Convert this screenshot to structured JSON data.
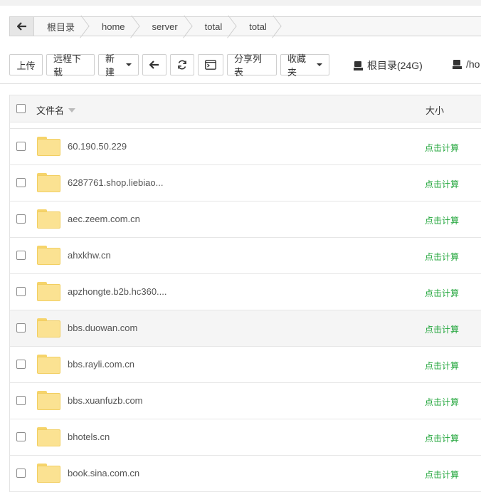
{
  "breadcrumb": {
    "items": [
      "根目录",
      "home",
      "server",
      "total",
      "total"
    ]
  },
  "toolbar": {
    "upload": "上传",
    "remote_download": "远程下载",
    "new": "新建",
    "share_list": "分享列表",
    "favorites": "收藏夹"
  },
  "disks": [
    {
      "label": "根目录(24G)"
    },
    {
      "label": "/ho"
    }
  ],
  "table": {
    "col_name": "文件名",
    "col_size": "大小",
    "rows": [
      {
        "name": "60.190.50.229",
        "size": "点击计算"
      },
      {
        "name": "6287761.shop.liebiao...",
        "size": "点击计算"
      },
      {
        "name": "aec.zeem.com.cn",
        "size": "点击计算"
      },
      {
        "name": "ahxkhw.cn",
        "size": "点击计算"
      },
      {
        "name": "apzhongte.b2b.hc360....",
        "size": "点击计算"
      },
      {
        "name": "bbs.duowan.com",
        "size": "点击计算"
      },
      {
        "name": "bbs.rayli.com.cn",
        "size": "点击计算"
      },
      {
        "name": "bbs.xuanfuzb.com",
        "size": "点击计算"
      },
      {
        "name": "bhotels.cn",
        "size": "点击计算"
      },
      {
        "name": "book.sina.com.cn",
        "size": "点击计算"
      }
    ]
  },
  "colors": {
    "accent_green": "#20a53a",
    "folder": "#fbe292"
  }
}
